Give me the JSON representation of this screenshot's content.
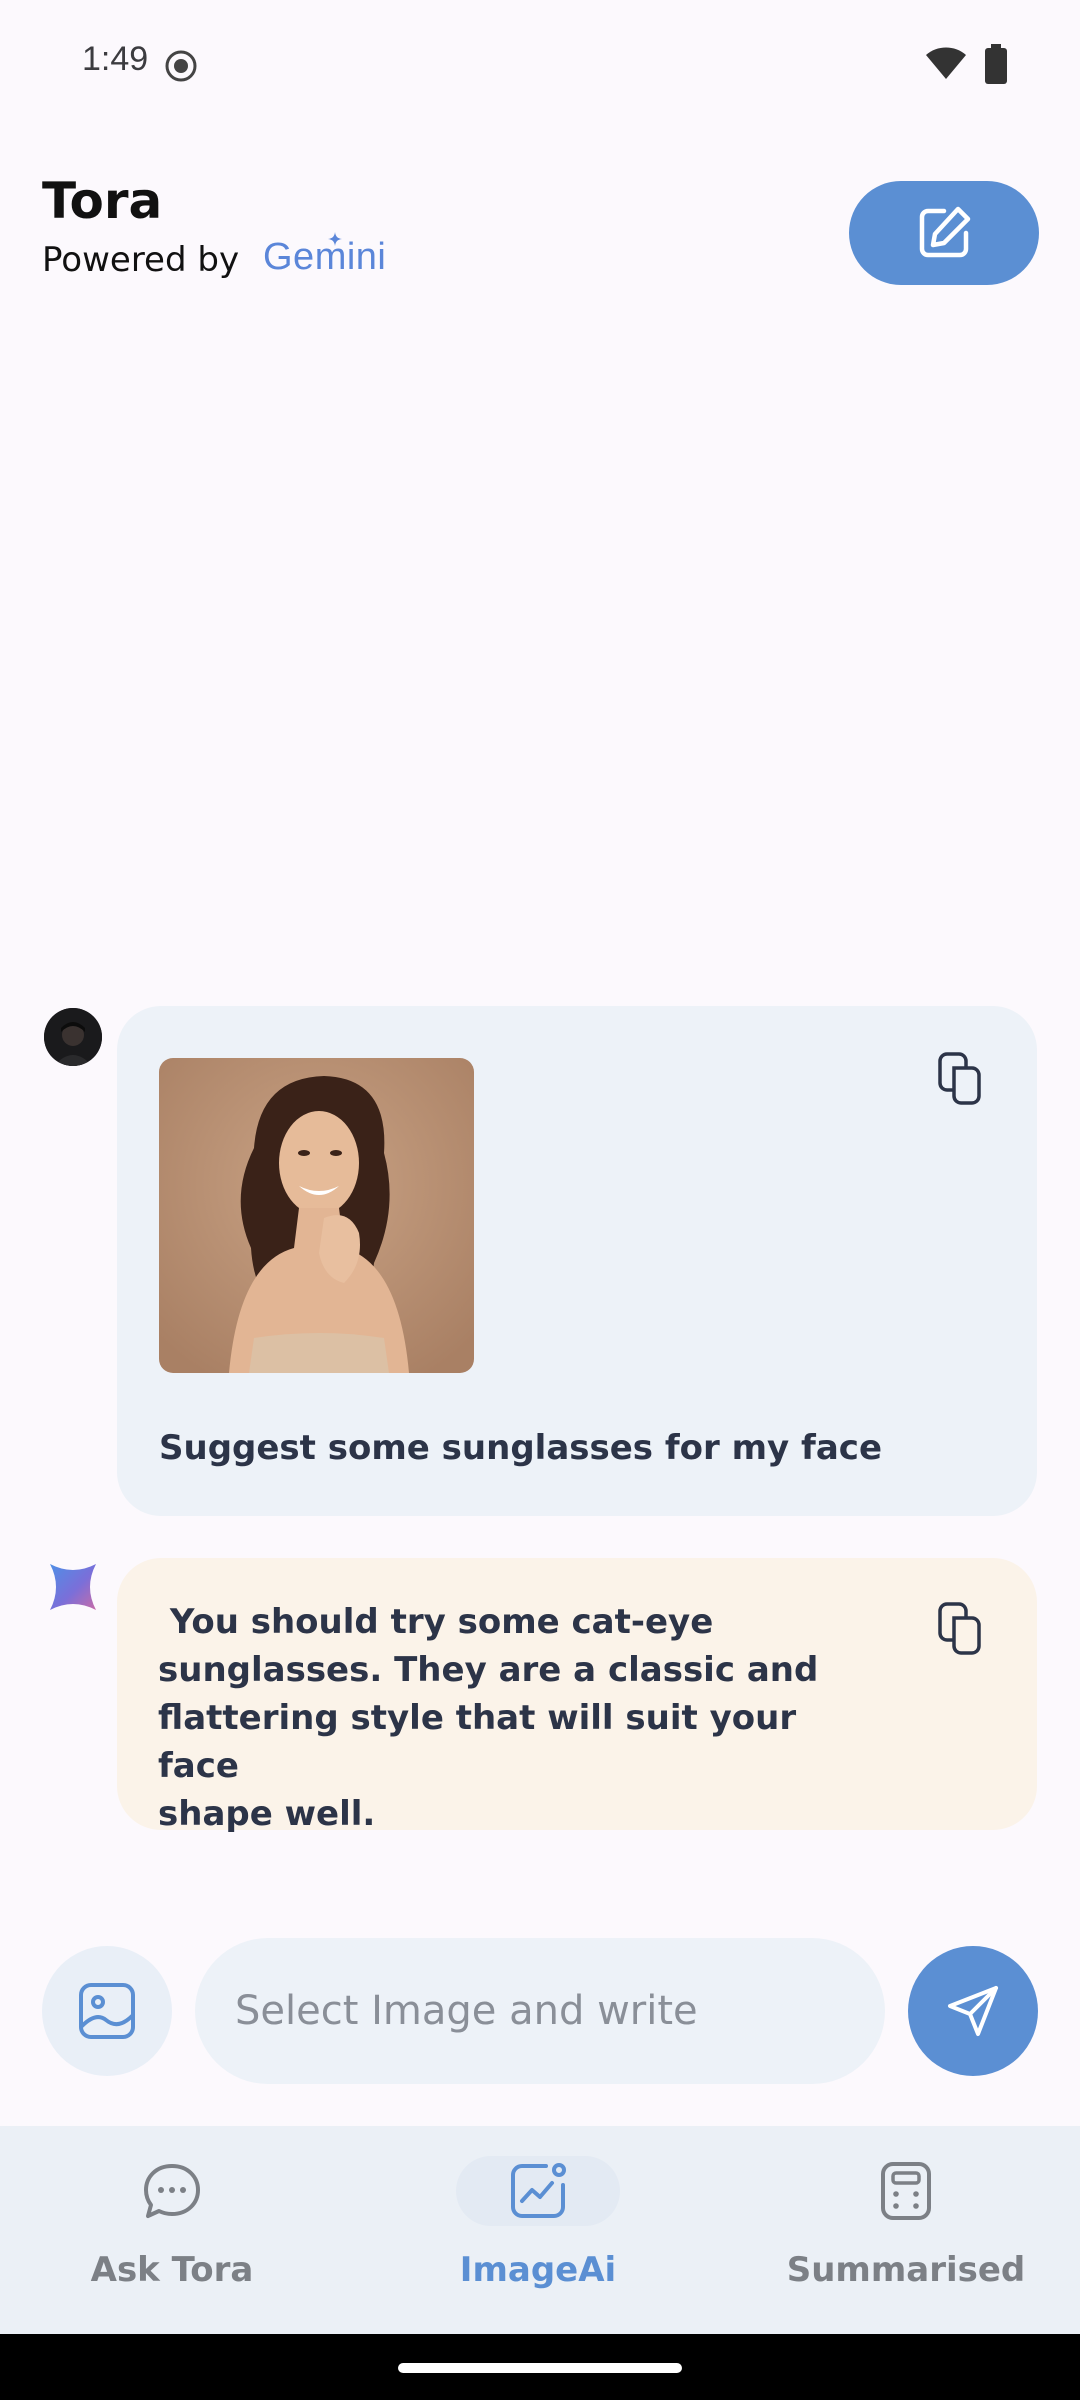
{
  "status_bar": {
    "time": "1:49"
  },
  "header": {
    "title": "Tora",
    "powered_by": "Powered by",
    "brand": "Gemini"
  },
  "chat": {
    "user_message": "Suggest some sunglasses for my face",
    "ai_message": " You should try some cat-eye\nsunglasses. They are a classic and\nflattering style that will suit your face\nshape well."
  },
  "input": {
    "placeholder": "Select Image and write"
  },
  "nav": {
    "items": [
      {
        "label": "Ask Tora",
        "icon": "chat-bubble-icon"
      },
      {
        "label": "ImageAi",
        "icon": "image-chart-icon"
      },
      {
        "label": "Summarised",
        "icon": "calculator-icon"
      }
    ],
    "active": "ImageAi"
  },
  "colors": {
    "accent": "#5b8fd3",
    "user_bubble": "#edf2f8",
    "ai_bubble": "#fbf3e9",
    "background": "#fcf9fd"
  }
}
